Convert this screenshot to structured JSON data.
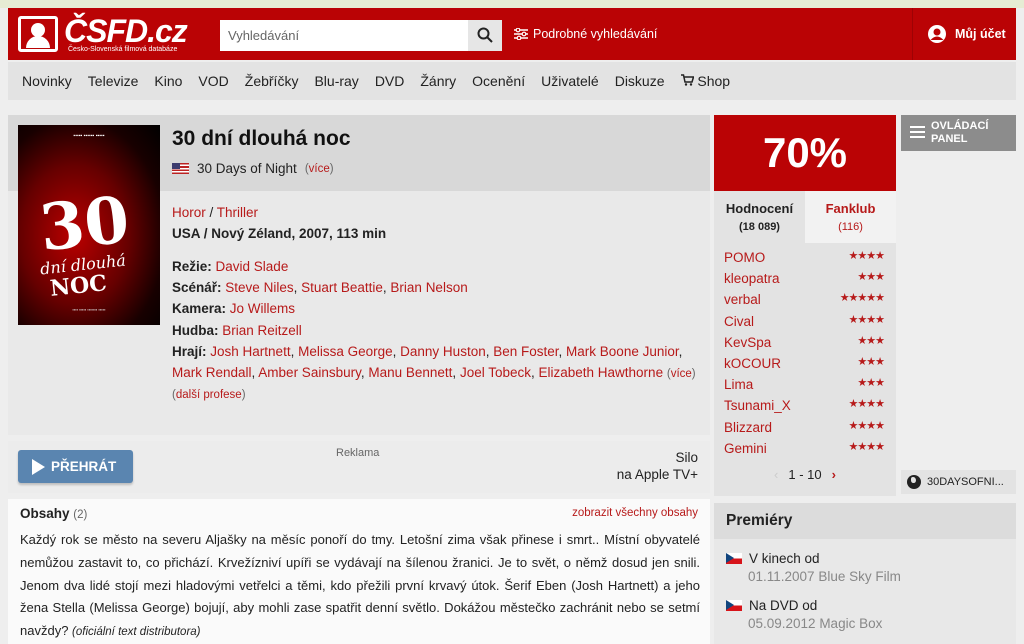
{
  "header": {
    "logo_text": "ČSFD.cz",
    "logo_subtitle": "Česko-Slovenská filmová databáze",
    "search_placeholder": "Vyhledávání",
    "advanced_search": "Podrobné vyhledávání",
    "account": "Můj účet"
  },
  "nav": [
    "Novinky",
    "Televize",
    "Kino",
    "VOD",
    "Žebříčky",
    "Blu-ray",
    "DVD",
    "Žánry",
    "Ocenění",
    "Uživatelé",
    "Diskuze",
    "Shop"
  ],
  "film": {
    "title": "30 dní dlouhá noc",
    "original_title": "30 Days of Night",
    "more_label": "více",
    "genres": [
      "Horor",
      "Thriller"
    ],
    "origin": "USA / Nový Zéland, 2007, 113 min",
    "poster": {
      "number": "30",
      "line1": "dní dlouhá",
      "line2": "NOC"
    },
    "crew": {
      "director_label": "Režie:",
      "director": "David Slade",
      "writers_label": "Scénář:",
      "writers": [
        "Steve Niles",
        "Stuart Beattie",
        "Brian Nelson"
      ],
      "camera_label": "Kamera:",
      "camera": "Jo Willems",
      "music_label": "Hudba:",
      "music": "Brian Reitzell",
      "cast_label": "Hrají:",
      "cast": [
        "Josh Hartnett",
        "Melissa George",
        "Danny Huston",
        "Ben Foster",
        "Mark Boone Junior",
        "Mark Rendall",
        "Amber Sainsbury",
        "Manu Bennett",
        "Joel Tobeck",
        "Elizabeth Hawthorne"
      ],
      "more": "více",
      "other_professions": "další profese"
    }
  },
  "player": {
    "play_label": "PŘEHRÁT",
    "ad_label": "Reklama",
    "ad_line1": "Silo",
    "ad_line2": "na Apple TV+"
  },
  "plot": {
    "heading": "Obsahy",
    "count": "(2)",
    "show_all": "zobrazit všechny obsahy",
    "text": "Každý rok se město na severu Aljašky na měsíc ponoří do tmy. Letošní zima však přinese i smrt.. Místní obyvatelé nemůžou zastavit to, co přichází. Krvežízniví upíři se vydávají na šílenou žranici. Je to svět, o němž dosud jen snili. Jenom dva lidé stojí mezi hladovými vetřelci a těmi, kdo přežili první krvavý útok. Šerif Eben (Josh Hartnett) a jeho žena Stella (Melissa George) bojují, aby mohli zase spatřit denní světlo. Dokážou městečko zachránit nebo se setmí navždy?",
    "source": "(oficiální text distributora)"
  },
  "rating": {
    "percent": "70%",
    "tab_ratings": "Hodnocení",
    "tab_ratings_count": "(18 089)",
    "tab_fanclub": "Fanklub",
    "tab_fanclub_count": "(116)",
    "users": [
      {
        "name": "POMO",
        "stars": "★★★★"
      },
      {
        "name": "kleopatra",
        "stars": "★★★"
      },
      {
        "name": "verbal",
        "stars": "★★★★★"
      },
      {
        "name": "Cival",
        "stars": "★★★★"
      },
      {
        "name": "KevSpa",
        "stars": "★★★"
      },
      {
        "name": "kOCOUR",
        "stars": "★★★"
      },
      {
        "name": "Lima",
        "stars": "★★★"
      },
      {
        "name": "Tsunami_X",
        "stars": "★★★★"
      },
      {
        "name": "Blizzard",
        "stars": "★★★★"
      },
      {
        "name": "Gemini",
        "stars": "★★★★"
      }
    ],
    "pager": "1 - 10"
  },
  "controls": {
    "panel_line1": "OVLÁDACÍ",
    "panel_line2": "PANEL",
    "external_link": "30DAYSOFNI..."
  },
  "premieres": {
    "heading": "Premiéry",
    "items": [
      {
        "title": "V kinech od",
        "detail": "01.11.2007 Blue Sky Film"
      },
      {
        "title": "Na DVD od",
        "detail": "05.09.2012 Magic Box"
      }
    ]
  },
  "colors": {
    "brand_red": "#ba0305",
    "link_red": "#b71a1a",
    "play_blue": "#5a85b0"
  }
}
